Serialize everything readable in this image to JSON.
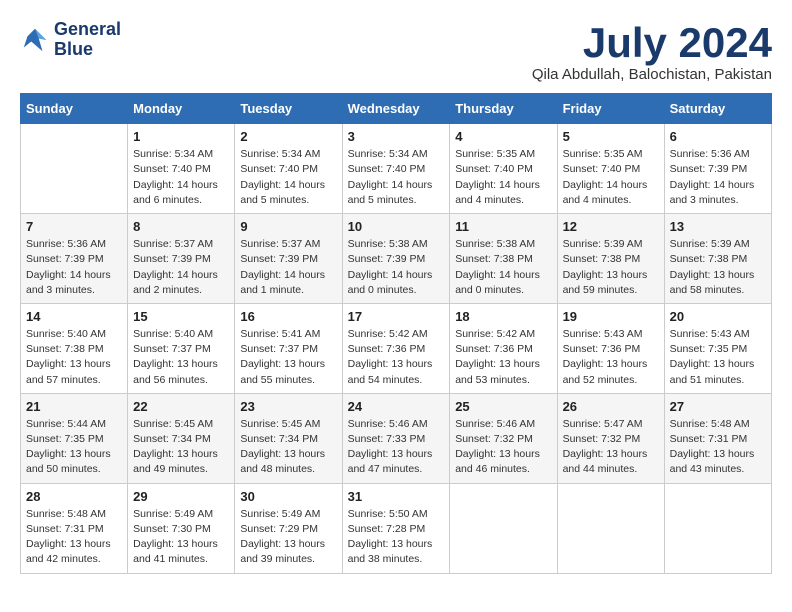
{
  "logo": {
    "line1": "General",
    "line2": "Blue"
  },
  "title": "July 2024",
  "location": "Qila Abdullah, Balochistan, Pakistan",
  "headers": [
    "Sunday",
    "Monday",
    "Tuesday",
    "Wednesday",
    "Thursday",
    "Friday",
    "Saturday"
  ],
  "weeks": [
    [
      {
        "day": "",
        "content": ""
      },
      {
        "day": "1",
        "content": "Sunrise: 5:34 AM\nSunset: 7:40 PM\nDaylight: 14 hours\nand 6 minutes."
      },
      {
        "day": "2",
        "content": "Sunrise: 5:34 AM\nSunset: 7:40 PM\nDaylight: 14 hours\nand 5 minutes."
      },
      {
        "day": "3",
        "content": "Sunrise: 5:34 AM\nSunset: 7:40 PM\nDaylight: 14 hours\nand 5 minutes."
      },
      {
        "day": "4",
        "content": "Sunrise: 5:35 AM\nSunset: 7:40 PM\nDaylight: 14 hours\nand 4 minutes."
      },
      {
        "day": "5",
        "content": "Sunrise: 5:35 AM\nSunset: 7:40 PM\nDaylight: 14 hours\nand 4 minutes."
      },
      {
        "day": "6",
        "content": "Sunrise: 5:36 AM\nSunset: 7:39 PM\nDaylight: 14 hours\nand 3 minutes."
      }
    ],
    [
      {
        "day": "7",
        "content": "Sunrise: 5:36 AM\nSunset: 7:39 PM\nDaylight: 14 hours\nand 3 minutes."
      },
      {
        "day": "8",
        "content": "Sunrise: 5:37 AM\nSunset: 7:39 PM\nDaylight: 14 hours\nand 2 minutes."
      },
      {
        "day": "9",
        "content": "Sunrise: 5:37 AM\nSunset: 7:39 PM\nDaylight: 14 hours\nand 1 minute."
      },
      {
        "day": "10",
        "content": "Sunrise: 5:38 AM\nSunset: 7:39 PM\nDaylight: 14 hours\nand 0 minutes."
      },
      {
        "day": "11",
        "content": "Sunrise: 5:38 AM\nSunset: 7:38 PM\nDaylight: 14 hours\nand 0 minutes."
      },
      {
        "day": "12",
        "content": "Sunrise: 5:39 AM\nSunset: 7:38 PM\nDaylight: 13 hours\nand 59 minutes."
      },
      {
        "day": "13",
        "content": "Sunrise: 5:39 AM\nSunset: 7:38 PM\nDaylight: 13 hours\nand 58 minutes."
      }
    ],
    [
      {
        "day": "14",
        "content": "Sunrise: 5:40 AM\nSunset: 7:38 PM\nDaylight: 13 hours\nand 57 minutes."
      },
      {
        "day": "15",
        "content": "Sunrise: 5:40 AM\nSunset: 7:37 PM\nDaylight: 13 hours\nand 56 minutes."
      },
      {
        "day": "16",
        "content": "Sunrise: 5:41 AM\nSunset: 7:37 PM\nDaylight: 13 hours\nand 55 minutes."
      },
      {
        "day": "17",
        "content": "Sunrise: 5:42 AM\nSunset: 7:36 PM\nDaylight: 13 hours\nand 54 minutes."
      },
      {
        "day": "18",
        "content": "Sunrise: 5:42 AM\nSunset: 7:36 PM\nDaylight: 13 hours\nand 53 minutes."
      },
      {
        "day": "19",
        "content": "Sunrise: 5:43 AM\nSunset: 7:36 PM\nDaylight: 13 hours\nand 52 minutes."
      },
      {
        "day": "20",
        "content": "Sunrise: 5:43 AM\nSunset: 7:35 PM\nDaylight: 13 hours\nand 51 minutes."
      }
    ],
    [
      {
        "day": "21",
        "content": "Sunrise: 5:44 AM\nSunset: 7:35 PM\nDaylight: 13 hours\nand 50 minutes."
      },
      {
        "day": "22",
        "content": "Sunrise: 5:45 AM\nSunset: 7:34 PM\nDaylight: 13 hours\nand 49 minutes."
      },
      {
        "day": "23",
        "content": "Sunrise: 5:45 AM\nSunset: 7:34 PM\nDaylight: 13 hours\nand 48 minutes."
      },
      {
        "day": "24",
        "content": "Sunrise: 5:46 AM\nSunset: 7:33 PM\nDaylight: 13 hours\nand 47 minutes."
      },
      {
        "day": "25",
        "content": "Sunrise: 5:46 AM\nSunset: 7:32 PM\nDaylight: 13 hours\nand 46 minutes."
      },
      {
        "day": "26",
        "content": "Sunrise: 5:47 AM\nSunset: 7:32 PM\nDaylight: 13 hours\nand 44 minutes."
      },
      {
        "day": "27",
        "content": "Sunrise: 5:48 AM\nSunset: 7:31 PM\nDaylight: 13 hours\nand 43 minutes."
      }
    ],
    [
      {
        "day": "28",
        "content": "Sunrise: 5:48 AM\nSunset: 7:31 PM\nDaylight: 13 hours\nand 42 minutes."
      },
      {
        "day": "29",
        "content": "Sunrise: 5:49 AM\nSunset: 7:30 PM\nDaylight: 13 hours\nand 41 minutes."
      },
      {
        "day": "30",
        "content": "Sunrise: 5:49 AM\nSunset: 7:29 PM\nDaylight: 13 hours\nand 39 minutes."
      },
      {
        "day": "31",
        "content": "Sunrise: 5:50 AM\nSunset: 7:28 PM\nDaylight: 13 hours\nand 38 minutes."
      },
      {
        "day": "",
        "content": ""
      },
      {
        "day": "",
        "content": ""
      },
      {
        "day": "",
        "content": ""
      }
    ]
  ]
}
